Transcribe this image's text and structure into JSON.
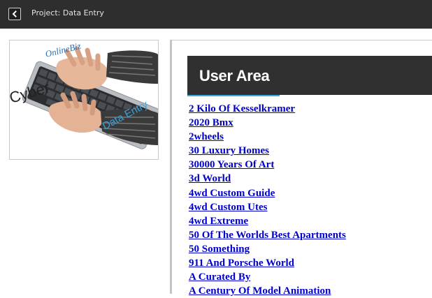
{
  "topbar": {
    "back_icon": "chevron-left-icon",
    "title": "Project: Data Entry"
  },
  "thumbnail": {
    "brand_word": "Cyber",
    "brand_script": "OnlineBiz",
    "caption": "Data Entry"
  },
  "user_area": {
    "title": "User Area",
    "accent_color": "#3aa9df",
    "links": [
      "2 Kilo Of Kesselkramer",
      "2020 Bmx",
      "2wheels",
      "30 Luxury Homes",
      "30000 Years Of Art",
      "3d World",
      "4wd Custom Guide",
      "4wd Custom Utes",
      "4wd Extreme",
      "50 Of The Worlds Best Apartments",
      "50 Something",
      "911 And Porsche World",
      "A Curated By",
      "A Century Of Model Animation"
    ]
  }
}
